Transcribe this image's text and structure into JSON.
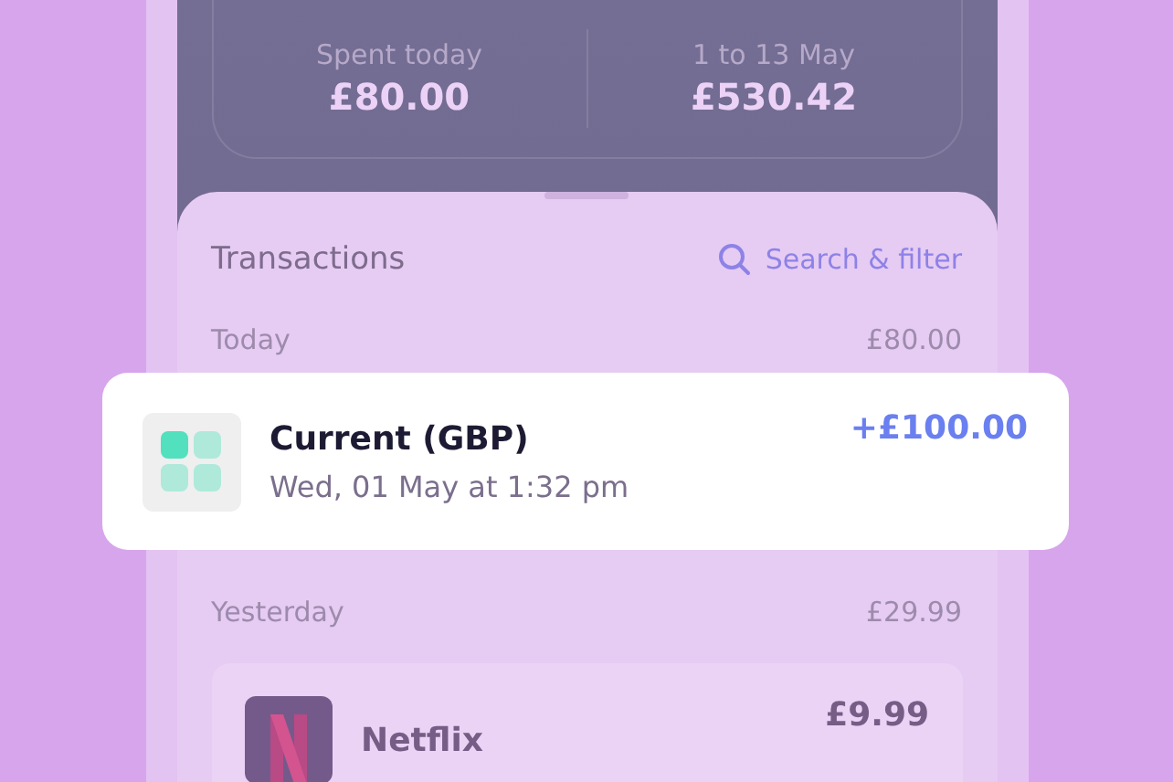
{
  "stats": [
    {
      "label": "Spent today",
      "value": "£80.00"
    },
    {
      "label": "1 to 13 May",
      "value": "£530.42"
    }
  ],
  "transactions": {
    "title": "Transactions",
    "search": "Search & filter",
    "groups": [
      {
        "label": "Today",
        "total": "£80.00",
        "items": [
          {
            "kind": "account",
            "title": "Current (GBP)",
            "subtitle": "Wed, 01 May at 1:32 pm",
            "amount": "+£100.00",
            "highlighted": true
          }
        ]
      },
      {
        "label": "Yesterday",
        "total": "£29.99",
        "items": [
          {
            "kind": "streaming",
            "title": "Netflix",
            "amount": "£9.99",
            "highlighted": false
          }
        ]
      }
    ]
  }
}
